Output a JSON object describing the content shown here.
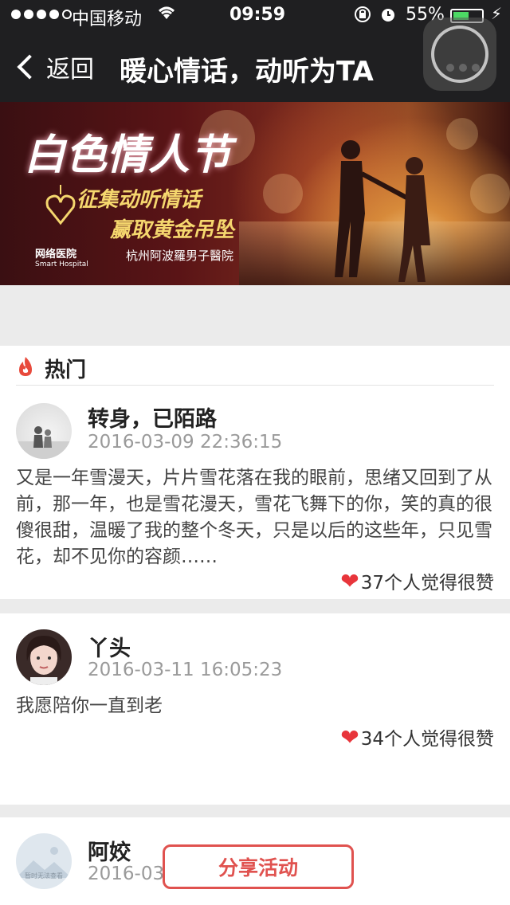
{
  "status_bar": {
    "carrier": "中国移动",
    "time": "09:59",
    "battery": "55%",
    "battery_level": 0.55
  },
  "nav": {
    "back_label": "返回",
    "title": "暖心情话，动听为TA"
  },
  "banner": {
    "title": "白色情人节",
    "line1": "征集动听情话",
    "line2": "赢取黄金吊坠",
    "logo1": "网络医院",
    "logo1_sub": "Smart Hospital",
    "logo2": "杭州阿波羅男子醫院"
  },
  "section": {
    "label": "热门"
  },
  "posts": [
    {
      "name": "转身，已陌路",
      "time": "2016-03-09 22:36:15",
      "content": "又是一年雪漫天，片片雪花落在我的眼前，思绪又回到了从前，那一年，也是雪花漫天，雪花飞舞下的你，笑的真的很傻很甜，温暖了我的整个冬天，只是以后的这些年，只见雪花，却不见你的容颜……",
      "likes": "37个人觉得很赞"
    },
    {
      "name": "丫头",
      "time": "2016-03-11 16:05:23",
      "content": "我愿陪你一直到老",
      "likes": "34个人觉得很赞"
    },
    {
      "name": "阿姣",
      "time": "2016-03-",
      "avatar_text": "暂时无法查看"
    }
  ],
  "share_button": "分享活动"
}
